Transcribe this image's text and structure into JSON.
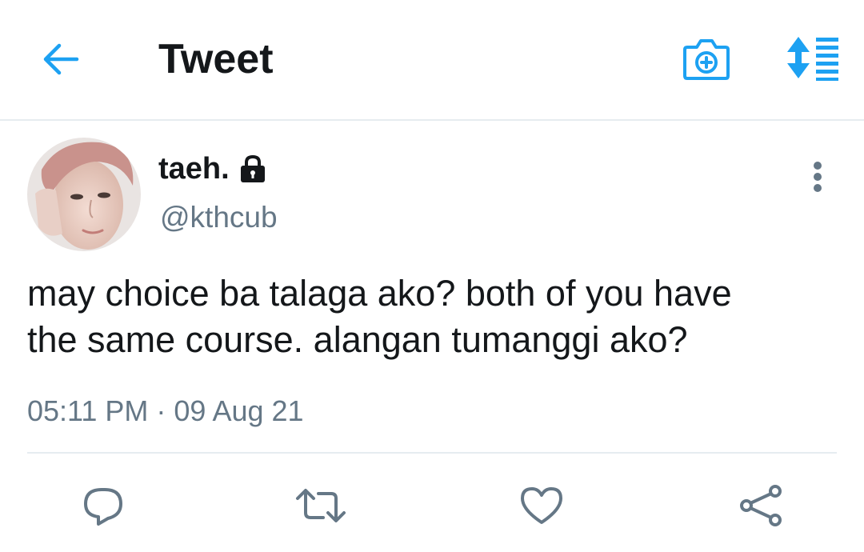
{
  "header": {
    "title": "Tweet",
    "icons": {
      "back": "arrow-left-icon",
      "camera": "camera-plus-icon",
      "sort": "sort-list-icon"
    }
  },
  "tweet": {
    "display_name": "taeh.",
    "protected_icon": "lock-icon",
    "handle": "@kthcub",
    "text_line1": "may choice ba talaga ako? both of you have",
    "text_line2": "the same course. alangan tumanggi ako?",
    "timestamp": "05:11 PM · 09 Aug 21",
    "more_icon": "more-vertical-icon"
  },
  "actions": {
    "reply_icon": "reply-icon",
    "retweet_icon": "retweet-icon",
    "like_icon": "heart-icon",
    "share_icon": "share-icon"
  },
  "colors": {
    "accent": "#1da1f2",
    "text": "#14171a",
    "secondary": "#657786",
    "divider": "#e6ecf0"
  }
}
